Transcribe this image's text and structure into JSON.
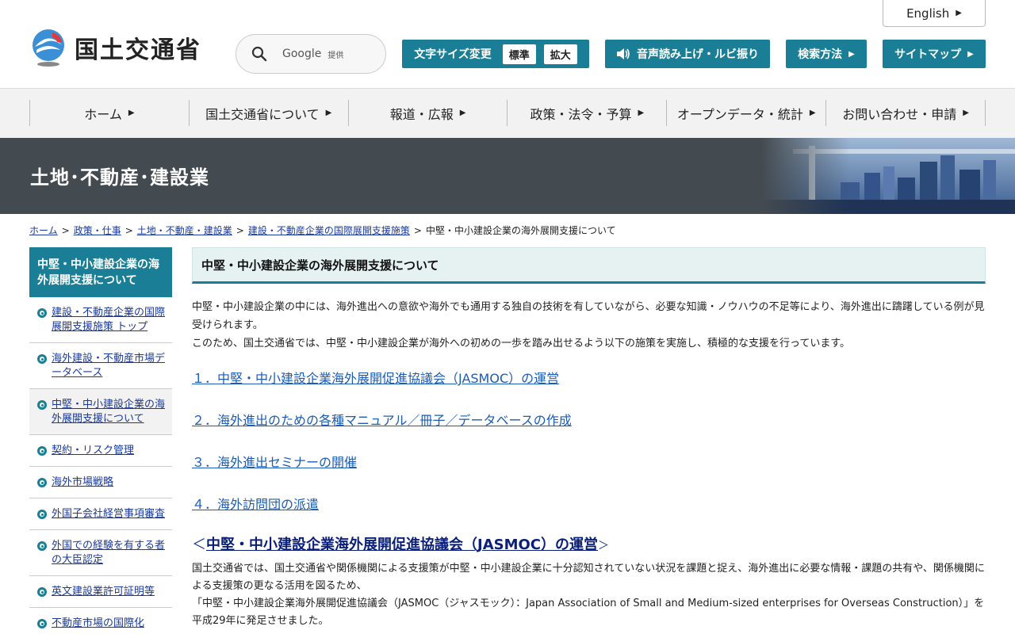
{
  "header": {
    "logo_text": "国土交通省",
    "english_label": "English",
    "search": {
      "google_label": "Google",
      "provided_label": "提供"
    },
    "font_size": {
      "label": "文字サイズ変更",
      "standard": "標準",
      "large": "拡大"
    },
    "voice_label": "音声読み上げ・ルビ振り",
    "search_method_label": "検索方法",
    "sitemap_label": "サイトマップ"
  },
  "gnav": {
    "items": [
      {
        "label": "ホーム"
      },
      {
        "label": "国土交通省について"
      },
      {
        "label": "報道・広報"
      },
      {
        "label": "政策・法令・予算"
      },
      {
        "label": "オープンデータ・統計"
      },
      {
        "label": "お問い合わせ・申請"
      }
    ]
  },
  "banner": {
    "title": "土地･不動産･建設業"
  },
  "breadcrumb": {
    "items": [
      {
        "label": "ホーム"
      },
      {
        "label": "政策・仕事"
      },
      {
        "label": "土地・不動産・建設業"
      },
      {
        "label": "建設・不動産企業の国際展開支援施策"
      }
    ],
    "current": "中堅・中小建設企業の海外展開支援について",
    "separator": ">"
  },
  "sidenav": {
    "heading": "中堅・中小建設企業の海外展開支援について",
    "items": [
      {
        "label": "建設・不動産企業の国際展開支援施策 トップ"
      },
      {
        "label": "海外建設・不動産市場データベース"
      },
      {
        "label": "中堅・中小建設企業の海外展開支援について"
      },
      {
        "label": "契約・リスク管理"
      },
      {
        "label": "海外市場戦略"
      },
      {
        "label": "外国子会社経営事項審査"
      },
      {
        "label": "外国での経験を有する者の大臣認定"
      },
      {
        "label": "英文建設業許可証明等"
      },
      {
        "label": "不動産市場の国際化"
      }
    ]
  },
  "main": {
    "title": "中堅・中小建設企業の海外展開支援について",
    "intro_1": "中堅・中小建設企業の中には、海外進出への意欲や海外でも通用する独自の技術を有していながら、必要な知識・ノウハウの不足等により、海外進出に躊躇している例が見受けられます。",
    "intro_2": "このため、国土交通省では、中堅・中小建設企業が海外への初めの一歩を踏み出せるよう以下の施策を実施し、積極的な支援を行っています。",
    "links": [
      {
        "label": "１．中堅・中小建設企業海外展開促進協議会（JASMOC）の運営"
      },
      {
        "label": "２．海外進出のための各種マニュアル／冊子／データベースの作成"
      },
      {
        "label": "３．海外進出セミナーの開催"
      },
      {
        "label": "４．海外訪問団の派遣"
      }
    ],
    "section": {
      "open": "＜",
      "title": "中堅・中小建設企業海外展開促進協議会（JASMOC）の運営",
      "close": "＞",
      "body_1": "国土交通省では、国土交通省や関係機関による支援策が中堅・中小建設企業に十分認知されていない状況を課題と捉え、海外進出に必要な情報・課題の共有や、関係機関による支援策の更なる活用を図るため、",
      "body_2": "「中堅・中小建設企業海外展開促進協議会（JASMOC（ジャスモック）：Japan Association of Small and Medium-sized enterprises for Overseas Construction）」を平成29年に発足させました。"
    }
  },
  "colors": {
    "teal": "#1a7f96",
    "banner_bg": "#444b50",
    "link": "#1a3a9c"
  }
}
